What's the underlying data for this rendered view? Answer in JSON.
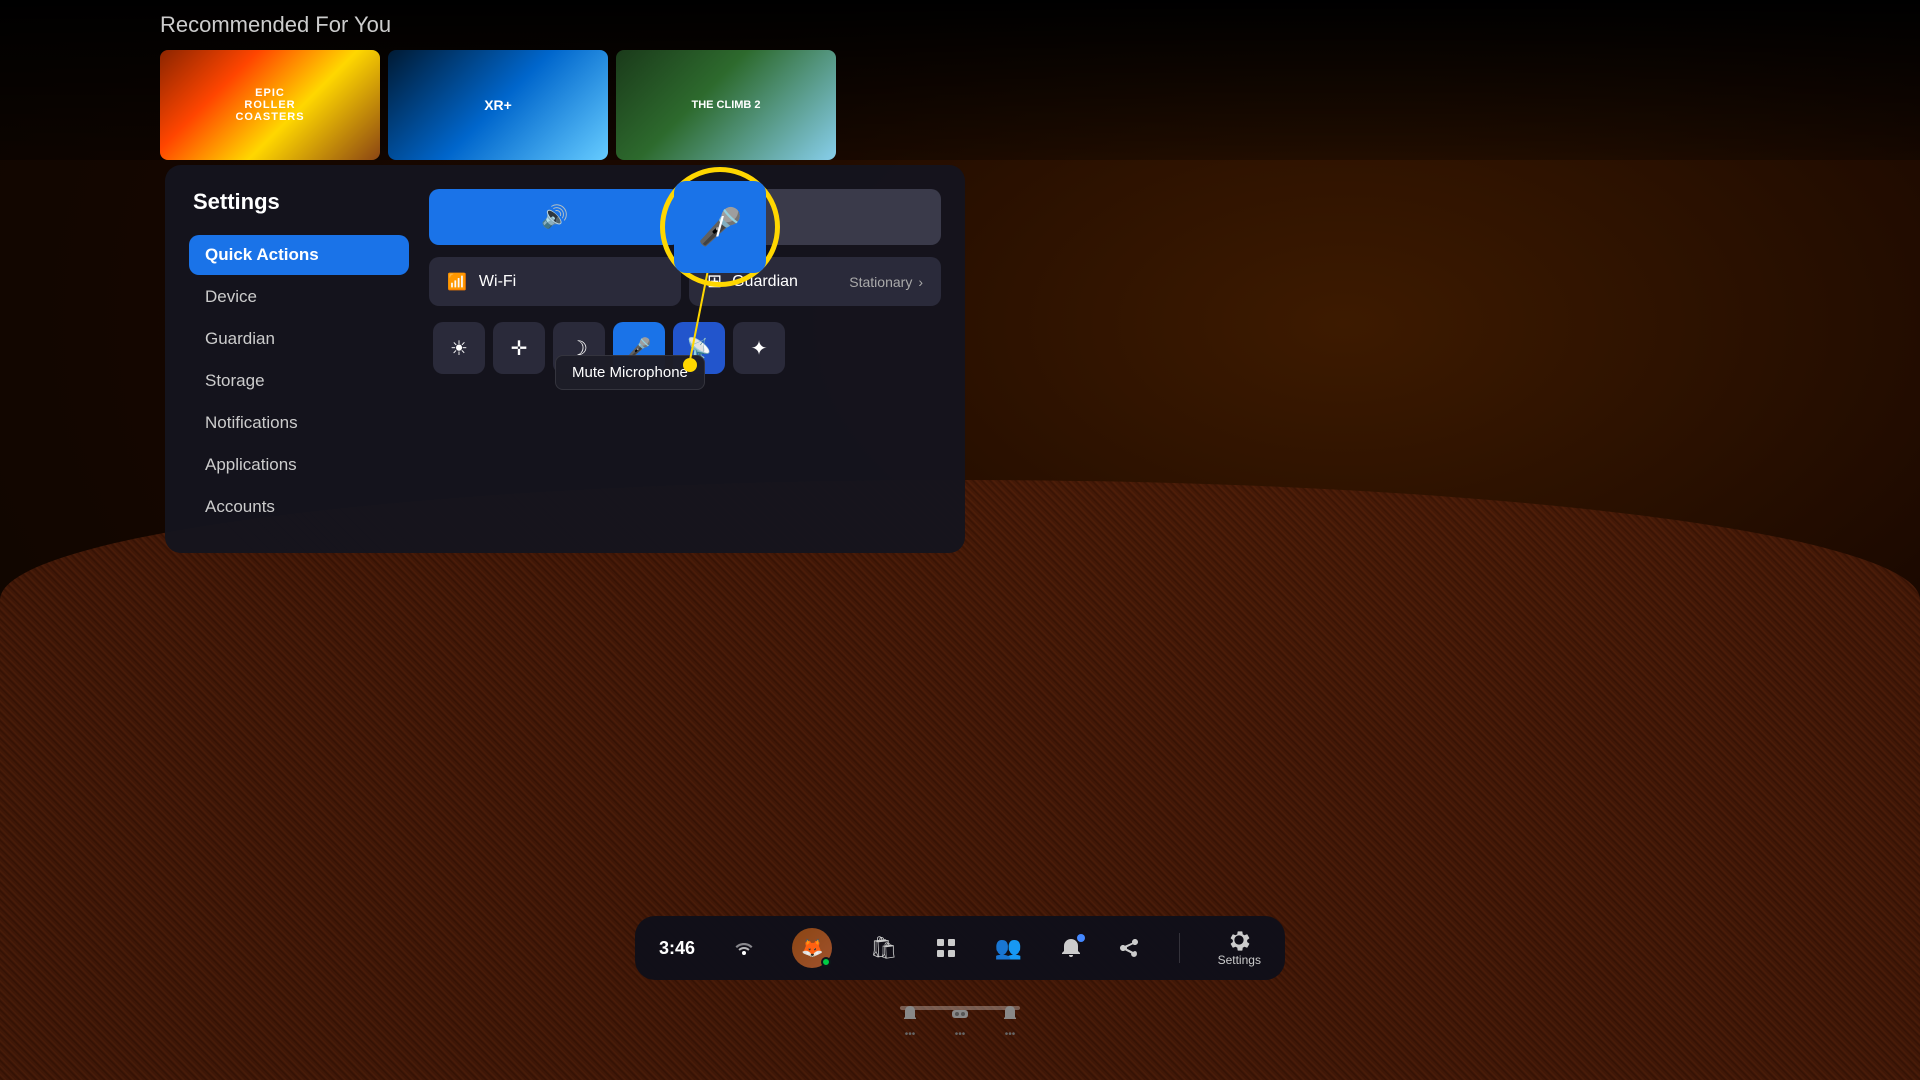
{
  "background": {
    "description": "VR room background with carpet"
  },
  "topBanner": {
    "label": "Recommended For You",
    "games": [
      {
        "name": "Epic Roller\nCoasters",
        "style": "orange"
      },
      {
        "name": "XR+",
        "style": "blue"
      },
      {
        "name": "The Climb 2",
        "style": "green"
      }
    ]
  },
  "settings": {
    "title": "Settings",
    "sidebar": {
      "items": [
        {
          "label": "Quick Actions",
          "active": true
        },
        {
          "label": "Device",
          "active": false
        },
        {
          "label": "Guardian",
          "active": false
        },
        {
          "label": "Storage",
          "active": false
        },
        {
          "label": "Notifications",
          "active": false
        },
        {
          "label": "Applications",
          "active": false
        },
        {
          "label": "Accounts",
          "active": false
        }
      ]
    },
    "quickActions": {
      "volumeIcon": "🔊",
      "muteMicIcon": "🎤",
      "wifiLabel": "Wi-Fi",
      "guardianLabel": "Guardian",
      "guardianStatus": "Stationary",
      "iconBar": [
        {
          "icon": "☀",
          "label": "brightness",
          "active": false
        },
        {
          "icon": "✛",
          "label": "move",
          "active": false
        },
        {
          "icon": "☾",
          "label": "sleep",
          "active": false
        },
        {
          "icon": "🎤",
          "label": "mute-mic",
          "active": true
        },
        {
          "icon": "📶",
          "label": "cast",
          "active": true
        },
        {
          "icon": "✦",
          "label": "more",
          "active": false
        }
      ]
    }
  },
  "tooltip": {
    "label": "Mute Microphone"
  },
  "taskbar": {
    "time": "3:46",
    "settingsLabel": "Settings",
    "icons": [
      {
        "name": "wifi-icon",
        "symbol": "📶"
      },
      {
        "name": "avatar",
        "symbol": "👤"
      },
      {
        "name": "store-icon",
        "symbol": "🛍"
      },
      {
        "name": "apps-icon",
        "symbol": "⊞"
      },
      {
        "name": "people-icon",
        "symbol": "👥"
      },
      {
        "name": "notifications-icon",
        "symbol": "🔔",
        "hasNotification": true
      },
      {
        "name": "share-icon",
        "symbol": "↗"
      },
      {
        "name": "settings-icon",
        "symbol": "⚙"
      }
    ],
    "subIcons": [
      {
        "name": "hand-left",
        "dots": "•••"
      },
      {
        "name": "vr-icon",
        "dots": "•••"
      },
      {
        "name": "hand-right",
        "dots": "•••"
      }
    ]
  }
}
